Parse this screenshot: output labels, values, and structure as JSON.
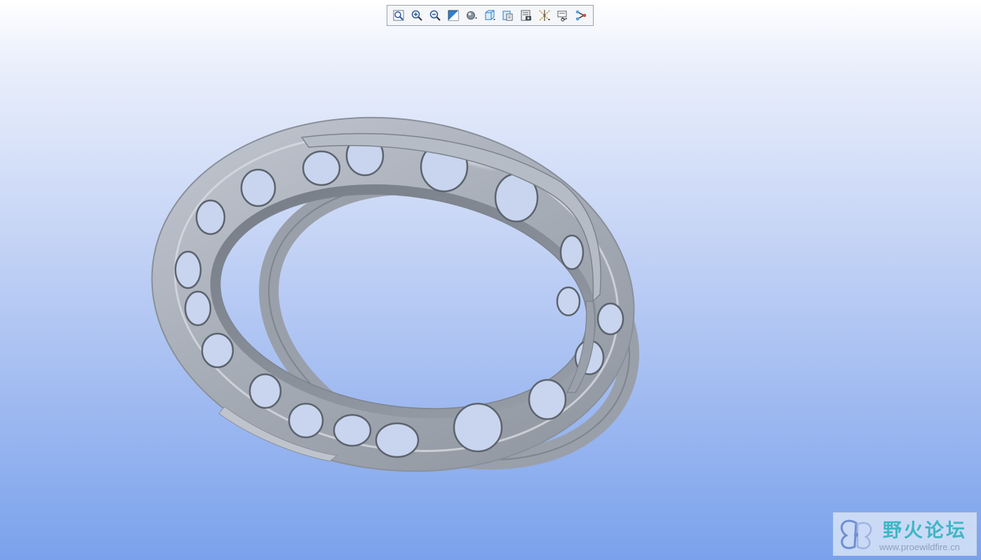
{
  "toolbar": {
    "tools": [
      {
        "name": "refit-icon"
      },
      {
        "name": "zoom-in-icon"
      },
      {
        "name": "zoom-out-icon"
      },
      {
        "name": "repaint-icon"
      },
      {
        "name": "display-style-icon"
      },
      {
        "name": "saved-views-icon"
      },
      {
        "name": "named-view-list-icon"
      },
      {
        "name": "view-manager-icon"
      },
      {
        "name": "datum-display-icon"
      },
      {
        "name": "spin-center-icon"
      },
      {
        "name": "annotation-display-icon"
      }
    ]
  },
  "model": {
    "description_color": "#aab0ba"
  },
  "watermark": {
    "title": "野火论坛",
    "url": "www.proewildfire.cn"
  },
  "colors": {
    "background_top": "#ffffff",
    "background_bottom": "#7aa2ec",
    "model_base": "#a7adb8",
    "model_shadow": "#636a74",
    "watermark_title": "#3fb6c4"
  }
}
